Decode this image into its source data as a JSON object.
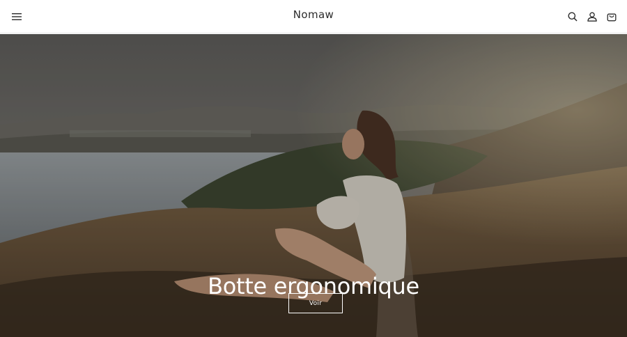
{
  "header": {
    "brand": "Nomaw",
    "icons": {
      "menu": "hamburger-menu-icon",
      "search": "search-icon",
      "account": "account-icon",
      "cart": "cart-icon"
    }
  },
  "hero": {
    "title": "Botte ergonomique",
    "button_label": "Voir"
  },
  "colors": {
    "header_bg": "#ffffff",
    "text_dark": "#2b2b2b",
    "hero_text": "#ffffff"
  }
}
